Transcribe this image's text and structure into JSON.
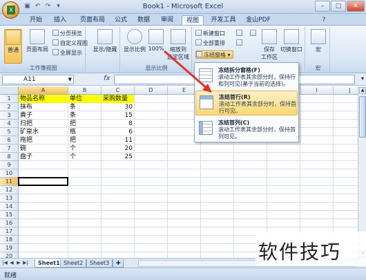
{
  "app": {
    "title": "Book1 - Microsoft Excel",
    "office_button_glyph": "X"
  },
  "qat": [
    "save-icon",
    "undo-icon",
    "redo-icon",
    "customize-icon"
  ],
  "tabs": [
    {
      "label": "开始"
    },
    {
      "label": "插入"
    },
    {
      "label": "页面布局"
    },
    {
      "label": "公式"
    },
    {
      "label": "数据"
    },
    {
      "label": "审阅"
    },
    {
      "label": "视图",
      "active": true
    },
    {
      "label": "开发工具"
    },
    {
      "label": "金山PDF"
    }
  ],
  "ribbon": {
    "workbook_views": {
      "label": "工作簿视图",
      "normal": "普通",
      "page_layout": "页面布局",
      "page_break": "分页预览",
      "custom_views": "自定义视图",
      "full_screen": "全屏显示"
    },
    "show_hide": {
      "label": "显示/隐藏"
    },
    "zoom": {
      "label": "显示比例",
      "zoom": "显示比例",
      "hundred": "100%",
      "zoom_to_selection_1": "缩放到",
      "zoom_to_selection_2": "选定区域"
    },
    "window": {
      "new_window": "新建窗口",
      "arrange_all": "全部重排",
      "freeze_panes": "冻结窗格",
      "save_workspace_1": "保存",
      "save_workspace_2": "工作区",
      "switch_windows": "切换窗口"
    },
    "macros": {
      "label": "宏",
      "btn": "宏"
    }
  },
  "formula_bar": {
    "name_box": "A11",
    "fx": "fx",
    "value": ""
  },
  "columns": [
    "A",
    "B",
    "C",
    "D",
    "E",
    "F",
    "G",
    "H",
    "I",
    "J"
  ],
  "rows": [
    "1",
    "2",
    "3",
    "4",
    "5",
    "6",
    "7",
    "8",
    "9",
    "10",
    "11",
    "12",
    "13",
    "14",
    "15",
    "16",
    "17",
    "18",
    "19",
    "20"
  ],
  "sheet": {
    "header": [
      "物品名称",
      "单位",
      "采购数量"
    ],
    "data": [
      [
        "抹布",
        "条",
        "30"
      ],
      [
        "粪子",
        "条",
        "15"
      ],
      [
        "扫把",
        "把",
        "8"
      ],
      [
        "矿泉水",
        "瓶",
        "6"
      ],
      [
        "拖把",
        "把",
        "11"
      ],
      [
        "碗",
        "个",
        "20"
      ],
      [
        "盘子",
        "个",
        "25"
      ]
    ]
  },
  "freeze_menu": [
    {
      "title": "冻结拆分窗格(F)",
      "desc": "滚动工作表其余部分时，保持行和列可见(基于当前的选择)。"
    },
    {
      "title": "冻结首行(R)",
      "desc": "滚动工作表其余部分时，保持首行可见。",
      "hover": true
    },
    {
      "title": "冻结首列(C)",
      "desc": "滚动工作表其余部分时，保持首列可见。"
    }
  ],
  "sheet_tabs": [
    {
      "label": "Sheet1",
      "active": true
    },
    {
      "label": "Sheet2"
    },
    {
      "label": "Sheet3"
    }
  ],
  "status": {
    "text": "就绪"
  },
  "watermark": "软件技巧",
  "colors": {
    "header_fill": "#ffff00",
    "arrow": "#e0312b",
    "menu_hover": "#fbd86f"
  }
}
